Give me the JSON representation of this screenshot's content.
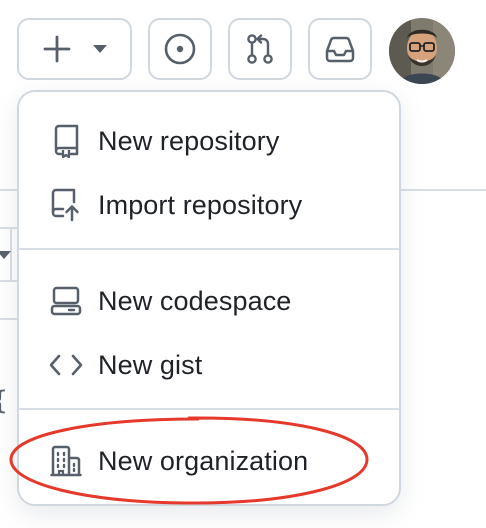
{
  "header": {
    "create_button": {
      "icon": "plus-icon",
      "caret": "triangle-down-icon"
    },
    "issues_button": {
      "icon": "issue-opened-icon"
    },
    "pull_requests_button": {
      "icon": "git-pull-request-icon"
    },
    "inbox_button": {
      "icon": "inbox-icon"
    },
    "avatar": {
      "icon": "user-avatar"
    }
  },
  "menu": {
    "items": [
      {
        "label": "New repository",
        "icon": "repo-icon"
      },
      {
        "label": "Import repository",
        "icon": "repo-push-icon"
      },
      {
        "label": "New codespace",
        "icon": "codespaces-icon"
      },
      {
        "label": "New gist",
        "icon": "code-icon"
      },
      {
        "label": "New organization",
        "icon": "organization-icon"
      }
    ]
  },
  "annotation": {
    "highlight_color": "#e5392b"
  },
  "colors": {
    "border": "#d0d7de",
    "icon": "#57606a",
    "text": "#1f2328"
  }
}
